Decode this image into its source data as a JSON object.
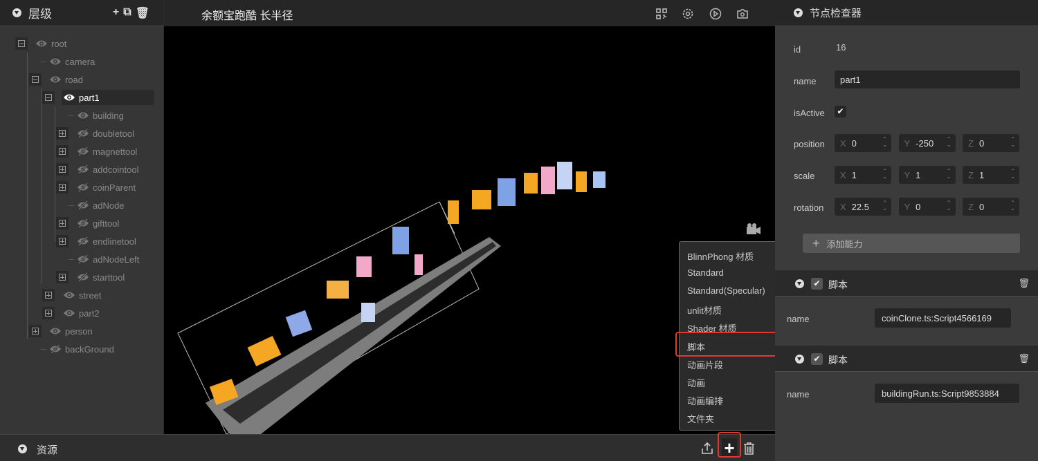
{
  "hierarchy": {
    "title": "层级",
    "icons": [
      "plus-icon",
      "copy-icon",
      "trash-icon"
    ],
    "nodes": [
      {
        "label": "root",
        "depth": 0,
        "expander": "minus",
        "visible": true
      },
      {
        "label": "camera",
        "depth": 1,
        "expander": null,
        "visible": true
      },
      {
        "label": "road",
        "depth": 1,
        "expander": "minus",
        "visible": true
      },
      {
        "label": "part1",
        "depth": 2,
        "expander": "minus",
        "visible": true,
        "selected": true
      },
      {
        "label": "building",
        "depth": 3,
        "expander": null,
        "visible": true
      },
      {
        "label": "doubletool",
        "depth": 3,
        "expander": "plus",
        "visible": false
      },
      {
        "label": "magnettool",
        "depth": 3,
        "expander": "plus",
        "visible": false
      },
      {
        "label": "addcointool",
        "depth": 3,
        "expander": "plus",
        "visible": false
      },
      {
        "label": "coinParent",
        "depth": 3,
        "expander": "plus",
        "visible": false
      },
      {
        "label": "adNode",
        "depth": 3,
        "expander": null,
        "visible": false
      },
      {
        "label": "gifttool",
        "depth": 3,
        "expander": "plus",
        "visible": false
      },
      {
        "label": "endlinetool",
        "depth": 3,
        "expander": "plus",
        "visible": false
      },
      {
        "label": "adNodeLeft",
        "depth": 3,
        "expander": null,
        "visible": false
      },
      {
        "label": "starttool",
        "depth": 3,
        "expander": "plus",
        "visible": false
      },
      {
        "label": "street",
        "depth": 2,
        "expander": "plus",
        "visible": true
      },
      {
        "label": "part2",
        "depth": 2,
        "expander": "plus",
        "visible": true
      },
      {
        "label": "person",
        "depth": 1,
        "expander": "plus",
        "visible": true
      },
      {
        "label": "backGround",
        "depth": 1,
        "expander": null,
        "visible": false
      }
    ]
  },
  "scene": {
    "title": "余额宝跑酷 长半径",
    "toolbar_icons": [
      "qrcode-icon",
      "settings-icon",
      "play-icon",
      "camera-icon"
    ]
  },
  "assets": {
    "title": "资源",
    "icons": [
      "upload-icon",
      "plus-icon",
      "trash-icon"
    ]
  },
  "create_menu": {
    "items": [
      "BlinnPhong 材质",
      "Standard",
      "Standard(Specular)",
      "unlit材质",
      "Shader 材质",
      "脚本",
      "动画片段",
      "动画",
      "动画编排",
      "文件夹"
    ],
    "highlighted": "脚本"
  },
  "inspector": {
    "title": "节点检查器",
    "id_label": "id",
    "id_value": "16",
    "name_label": "name",
    "name_value": "part1",
    "active_label": "isActive",
    "active": true,
    "position_label": "position",
    "position": {
      "x": "0",
      "y": "-250",
      "z": "0"
    },
    "scale_label": "scale",
    "scale": {
      "x": "1",
      "y": "1",
      "z": "1"
    },
    "rotation_label": "rotation",
    "rotation": {
      "x": "22.5",
      "y": "0",
      "z": "0"
    },
    "add_ability": "添加能力",
    "components": [
      {
        "title": "脚本",
        "enabled": true,
        "name_label": "name",
        "name_value": "coinClone.ts:Script4566169"
      },
      {
        "title": "脚本",
        "enabled": true,
        "name_label": "name",
        "name_value": "buildingRun.ts:Script9853884"
      }
    ]
  },
  "colors": {
    "highlight": "#e03a2e",
    "panel": "#3b3b3c",
    "header": "#262626",
    "viewport": "#000000"
  }
}
